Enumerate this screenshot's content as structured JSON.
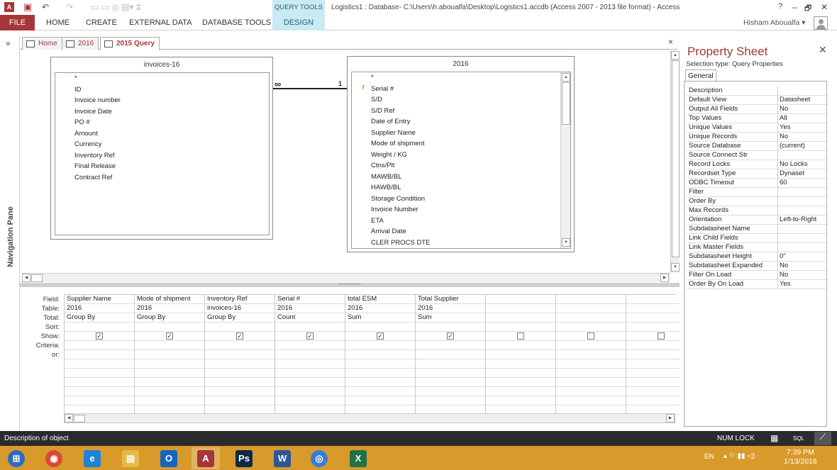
{
  "window": {
    "title": "Logistics1 : Database- C:\\Users\\h.aboualfa\\Desktop\\Logistics1.accdb (Access 2007 - 2013 file format) - Access",
    "context_tool": "QUERY TOOLS",
    "help": "?",
    "min": "–",
    "restore": "🗗",
    "close": "✕",
    "undo_icon": "↶",
    "redo_icon": "↷"
  },
  "ribbon": {
    "file": "FILE",
    "tabs": [
      "HOME",
      "CREATE",
      "EXTERNAL DATA",
      "DATABASE TOOLS"
    ],
    "design": "DESIGN",
    "user": "Hisham Aboualfa ▾"
  },
  "nav": {
    "label": "Navigation Pane",
    "chevron": "»"
  },
  "doc_tabs": [
    {
      "label": "Home"
    },
    {
      "label": "2016"
    },
    {
      "label": "2015 Query"
    }
  ],
  "doc_close": "×",
  "tables": {
    "left": {
      "title": "invoices-16",
      "fields": [
        "*",
        "ID",
        "Invoice number",
        "Invoice Date",
        "PO #",
        "Amount",
        "Currency",
        "Inventory Ref",
        "Final Release",
        "Contract Ref"
      ]
    },
    "right": {
      "title": "2016",
      "fields": [
        "*",
        "Serial #",
        "S/D",
        "S/D Ref",
        "Date of Entry",
        "Supplier Name",
        "Mode of shipment",
        "Weight / KG",
        "Ctns/Plt",
        "MAWB/BL",
        "HAWB/BL",
        "Storage Condition",
        "Invoice Number",
        "ETA",
        "Arrival Date",
        "CLER PROCS DTE"
      ],
      "key_icon": "🔑"
    },
    "join": {
      "left": "∞",
      "right": "1"
    }
  },
  "grid": {
    "row_labels": [
      "Field:",
      "Table:",
      "Total:",
      "Sort:",
      "Show:",
      "Criteria:",
      "or:"
    ],
    "columns": [
      {
        "field": "Supplier Name",
        "table": "2016",
        "total": "Group By",
        "show": true
      },
      {
        "field": "Mode of shipment",
        "table": "2016",
        "total": "Group By",
        "show": true
      },
      {
        "field": "Inventory Ref",
        "table": "invoices-16",
        "total": "Group By",
        "show": true
      },
      {
        "field": "Serial #",
        "table": "2016",
        "total": "Count",
        "show": true
      },
      {
        "field": "total ESM",
        "table": "2016",
        "total": "Sum",
        "show": true
      },
      {
        "field": "Total Supplier",
        "table": "2016",
        "total": "Sum",
        "show": true
      },
      {
        "field": "",
        "table": "",
        "total": "",
        "show": false
      },
      {
        "field": "",
        "table": "",
        "total": "",
        "show": false
      },
      {
        "field": "",
        "table": "",
        "total": "",
        "show": false
      }
    ],
    "check": "✓"
  },
  "property_sheet": {
    "title": "Property Sheet",
    "close": "✕",
    "selection_type": "Selection type:  Query Properties",
    "tab": "General",
    "rows": [
      {
        "name": "Description",
        "value": ""
      },
      {
        "name": "Default View",
        "value": "Datasheet"
      },
      {
        "name": "Output All Fields",
        "value": "No"
      },
      {
        "name": "Top Values",
        "value": "All"
      },
      {
        "name": "Unique Values",
        "value": "Yes"
      },
      {
        "name": "Unique Records",
        "value": "No"
      },
      {
        "name": "Source Database",
        "value": "(current)"
      },
      {
        "name": "Source Connect Str",
        "value": ""
      },
      {
        "name": "Record Locks",
        "value": "No Locks"
      },
      {
        "name": "Recordset Type",
        "value": "Dynaset"
      },
      {
        "name": "ODBC Timeout",
        "value": "60"
      },
      {
        "name": "Filter",
        "value": ""
      },
      {
        "name": "Order By",
        "value": ""
      },
      {
        "name": "Max Records",
        "value": ""
      },
      {
        "name": "Orientation",
        "value": "Left-to-Right"
      },
      {
        "name": "Subdatasheet Name",
        "value": ""
      },
      {
        "name": "Link Child Fields",
        "value": ""
      },
      {
        "name": "Link Master Fields",
        "value": ""
      },
      {
        "name": "Subdatasheet Height",
        "value": "0\""
      },
      {
        "name": "Subdatasheet Expanded",
        "value": "No"
      },
      {
        "name": "Filter On Load",
        "value": "No"
      },
      {
        "name": "Order By On Load",
        "value": "Yes"
      }
    ]
  },
  "status": {
    "left": "Description of object",
    "numlock": "NUM LOCK",
    "sql": "SQL"
  },
  "taskbar": {
    "apps": [
      {
        "name": "start",
        "glyph": "⊞",
        "color": "#2d6cc0"
      },
      {
        "name": "chrome",
        "glyph": "◉",
        "color": "#d84a38"
      },
      {
        "name": "ie",
        "glyph": "e",
        "color": "#1b84d6"
      },
      {
        "name": "explorer",
        "glyph": "▤",
        "color": "#e5b94b"
      },
      {
        "name": "outlook",
        "glyph": "O",
        "color": "#1565c0"
      },
      {
        "name": "access",
        "glyph": "A",
        "color": "#a4373a"
      },
      {
        "name": "photoshop",
        "glyph": "Ps",
        "color": "#0b2a4a"
      },
      {
        "name": "word",
        "glyph": "W",
        "color": "#2b579a"
      },
      {
        "name": "app9",
        "glyph": "◎",
        "color": "#3a7bd5"
      },
      {
        "name": "excel",
        "glyph": "X",
        "color": "#217346"
      }
    ],
    "lang": "EN",
    "time": "7:39 PM",
    "date": "1/13/2016"
  }
}
